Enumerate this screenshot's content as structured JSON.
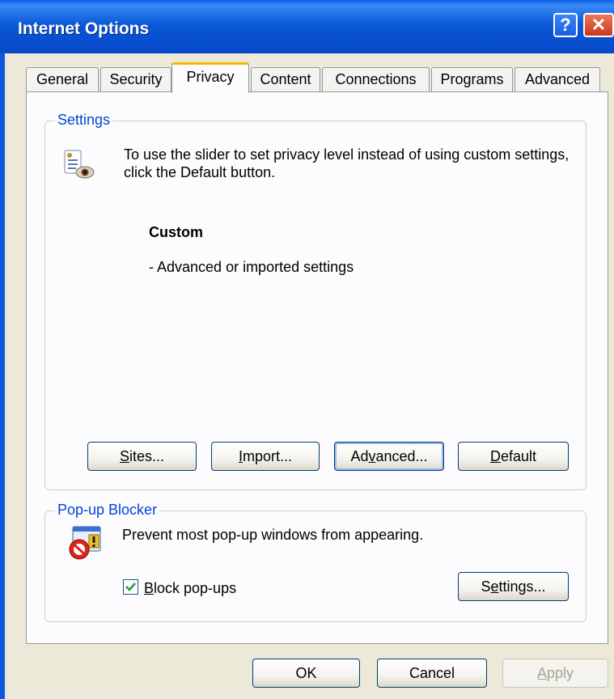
{
  "window": {
    "title": "Internet Options",
    "help_label": "?",
    "close_label": "✕"
  },
  "tabs": [
    {
      "label": "General"
    },
    {
      "label": "Security"
    },
    {
      "label": "Privacy",
      "active": true
    },
    {
      "label": "Content"
    },
    {
      "label": "Connections"
    },
    {
      "label": "Programs"
    },
    {
      "label": "Advanced"
    }
  ],
  "settings": {
    "group_title": "Settings",
    "description": "To use the slider to set privacy level instead of using custom settings, click the Default button.",
    "level_title": "Custom",
    "level_detail": "- Advanced or imported settings",
    "buttons": {
      "sites": {
        "prefix": "",
        "accel": "S",
        "suffix": "ites..."
      },
      "import": {
        "prefix": "",
        "accel": "I",
        "suffix": "mport..."
      },
      "advanced": {
        "prefix": "Ad",
        "accel": "v",
        "suffix": "anced..."
      },
      "default": {
        "prefix": "",
        "accel": "D",
        "suffix": "efault"
      }
    }
  },
  "popup_blocker": {
    "group_title": "Pop-up Blocker",
    "description": "Prevent most pop-up windows from appearing.",
    "checkbox": {
      "prefix": "",
      "accel": "B",
      "suffix": "lock pop-ups",
      "checked": true
    },
    "settings_button": {
      "prefix": "S",
      "accel": "e",
      "suffix": "ttings..."
    }
  },
  "dialog_buttons": {
    "ok": "OK",
    "cancel": "Cancel",
    "apply": {
      "prefix": "",
      "accel": "A",
      "suffix": "pply"
    }
  }
}
